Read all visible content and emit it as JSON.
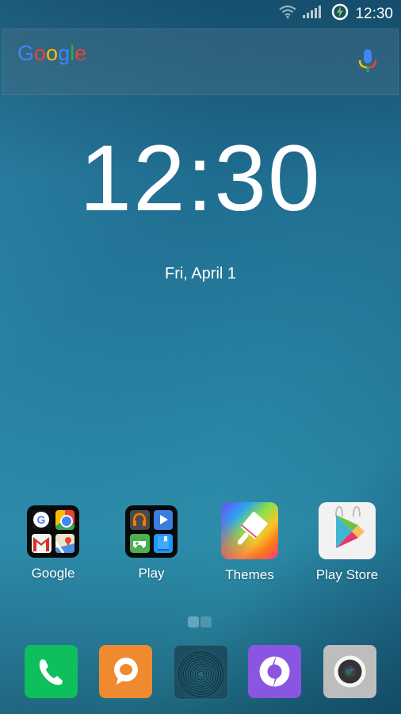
{
  "status_bar": {
    "time": "12:30",
    "icons": [
      "wifi-icon",
      "signal-icon",
      "battery-charging-icon"
    ]
  },
  "search_widget": {
    "logo_text": "Google",
    "logo_letters": [
      {
        "char": "G",
        "color": "#4285F4"
      },
      {
        "char": "o",
        "color": "#EA4335"
      },
      {
        "char": "o",
        "color": "#FBBC05"
      },
      {
        "char": "g",
        "color": "#4285F4"
      },
      {
        "char": "l",
        "color": "#34A853"
      },
      {
        "char": "e",
        "color": "#EA4335"
      }
    ],
    "voice_icon": "mic-icon"
  },
  "clock_widget": {
    "time": "12:30",
    "date": "Fri, April 1"
  },
  "home_apps": [
    {
      "label": "Google",
      "type": "folder",
      "contents": [
        "google-search",
        "chrome",
        "gmail",
        "maps"
      ]
    },
    {
      "label": "Play",
      "type": "folder",
      "contents": [
        "play-music",
        "play-movies",
        "play-games",
        "play-books"
      ]
    },
    {
      "label": "Themes",
      "type": "app",
      "icon": "paintbrush-icon"
    },
    {
      "label": "Play Store",
      "type": "app",
      "icon": "play-store-icon"
    }
  ],
  "page_indicator": {
    "pages": 2,
    "current": 1
  },
  "dock": [
    {
      "name": "phone",
      "icon": "phone-icon",
      "color": "#0EBF5C"
    },
    {
      "name": "messages",
      "icon": "message-icon",
      "color": "#F08A2E"
    },
    {
      "name": "fingerprint",
      "icon": "fingerprint-icon",
      "color": "#1d5a70"
    },
    {
      "name": "browser",
      "icon": "browser-icon",
      "color": "#8A55E0"
    },
    {
      "name": "camera",
      "icon": "camera-icon",
      "color": "#BDBDBD"
    }
  ]
}
